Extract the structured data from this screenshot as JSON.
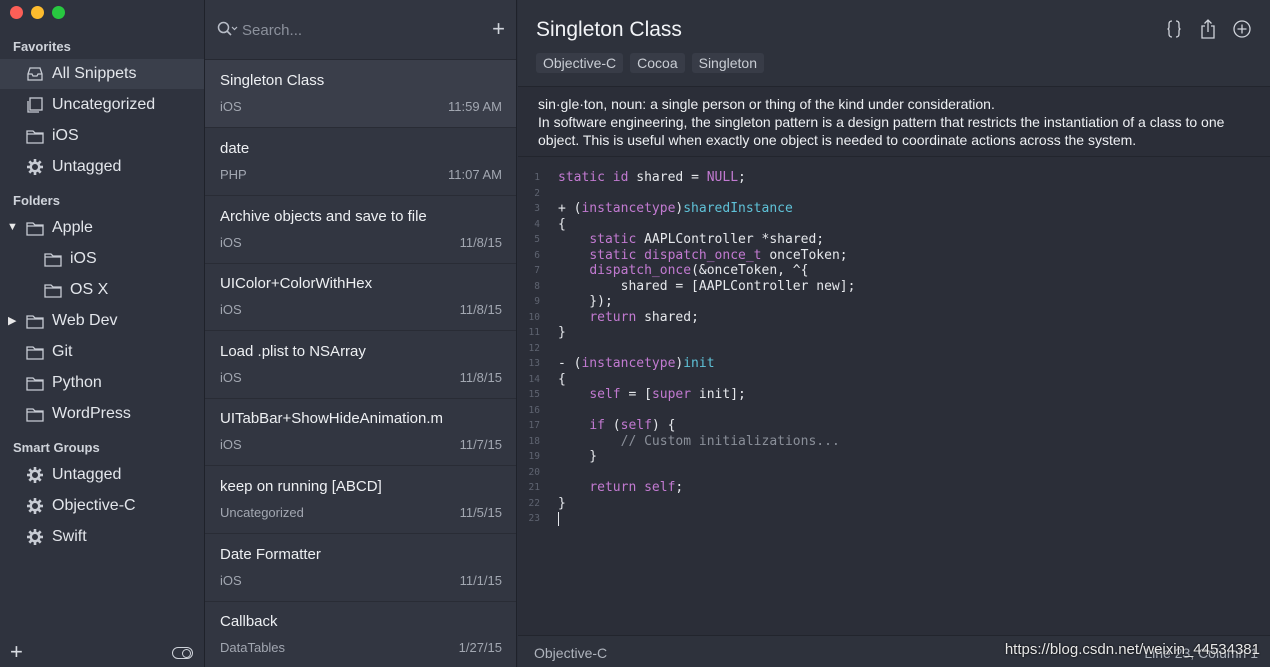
{
  "sidebar": {
    "favorites_title": "Favorites",
    "favorites": [
      {
        "label": "All Snippets",
        "icon": "tray-icon"
      },
      {
        "label": "Uncategorized",
        "icon": "stack-icon"
      },
      {
        "label": "iOS",
        "icon": "folder-icon"
      },
      {
        "label": "Untagged",
        "icon": "gear-icon"
      }
    ],
    "folders_title": "Folders",
    "folders": [
      {
        "label": "Apple",
        "icon": "folder-icon",
        "expanded": true
      },
      {
        "label": "iOS",
        "icon": "folder-icon"
      },
      {
        "label": "OS X",
        "icon": "folder-icon"
      },
      {
        "label": "Web Dev",
        "icon": "folder-icon",
        "expanded": false
      },
      {
        "label": "Git",
        "icon": "folder-icon"
      },
      {
        "label": "Python",
        "icon": "folder-icon"
      },
      {
        "label": "WordPress",
        "icon": "folder-icon"
      }
    ],
    "smart_title": "Smart Groups",
    "smart": [
      {
        "label": "Untagged",
        "icon": "gear-icon"
      },
      {
        "label": "Objective-C",
        "icon": "gear-icon"
      },
      {
        "label": "Swift",
        "icon": "gear-icon"
      }
    ]
  },
  "search": {
    "placeholder": "Search..."
  },
  "snippets": [
    {
      "title": "Singleton Class",
      "category": "iOS",
      "date": "11:59 AM"
    },
    {
      "title": "date",
      "category": "PHP",
      "date": "11:07 AM"
    },
    {
      "title": "Archive objects and save to file",
      "category": "iOS",
      "date": "11/8/15"
    },
    {
      "title": "UIColor+ColorWithHex",
      "category": "iOS",
      "date": "11/8/15"
    },
    {
      "title": "Load .plist to NSArray",
      "category": "iOS",
      "date": "11/8/15"
    },
    {
      "title": "UITabBar+ShowHideAnimation.m",
      "category": "iOS",
      "date": "11/7/15"
    },
    {
      "title": "keep on running [ABCD]",
      "category": "Uncategorized",
      "date": "11/5/15"
    },
    {
      "title": "Date Formatter",
      "category": "iOS",
      "date": "11/1/15"
    },
    {
      "title": "Callback",
      "category": "DataTables",
      "date": "1/27/15"
    }
  ],
  "detail": {
    "title": "Singleton Class",
    "tags": [
      "Objective-C",
      "Cocoa",
      "Singleton"
    ],
    "description_1": "sin·gle·ton, noun: a single person or thing of the kind under consideration.",
    "description_2": "In software engineering, the singleton pattern is a design pattern that restricts the instantiation of a class to one object. This is useful when exactly one object is needed to coordinate actions across the system.",
    "line_numbers": [
      "1",
      "2",
      "3",
      "4",
      "5",
      "6",
      "7",
      "8",
      "9",
      "10",
      "11",
      "12",
      "13",
      "14",
      "15",
      "16",
      "17",
      "18",
      "19",
      "20",
      "21",
      "22",
      "23"
    ],
    "language": "Objective-C",
    "cursor_position": "Line 23, Column 1"
  },
  "watermark": "https://blog.csdn.net/weixin_44534381",
  "colors": {
    "accent_keyword": "#c27ad1",
    "accent_function": "#5fc2d8",
    "comment": "#8a8f99"
  }
}
